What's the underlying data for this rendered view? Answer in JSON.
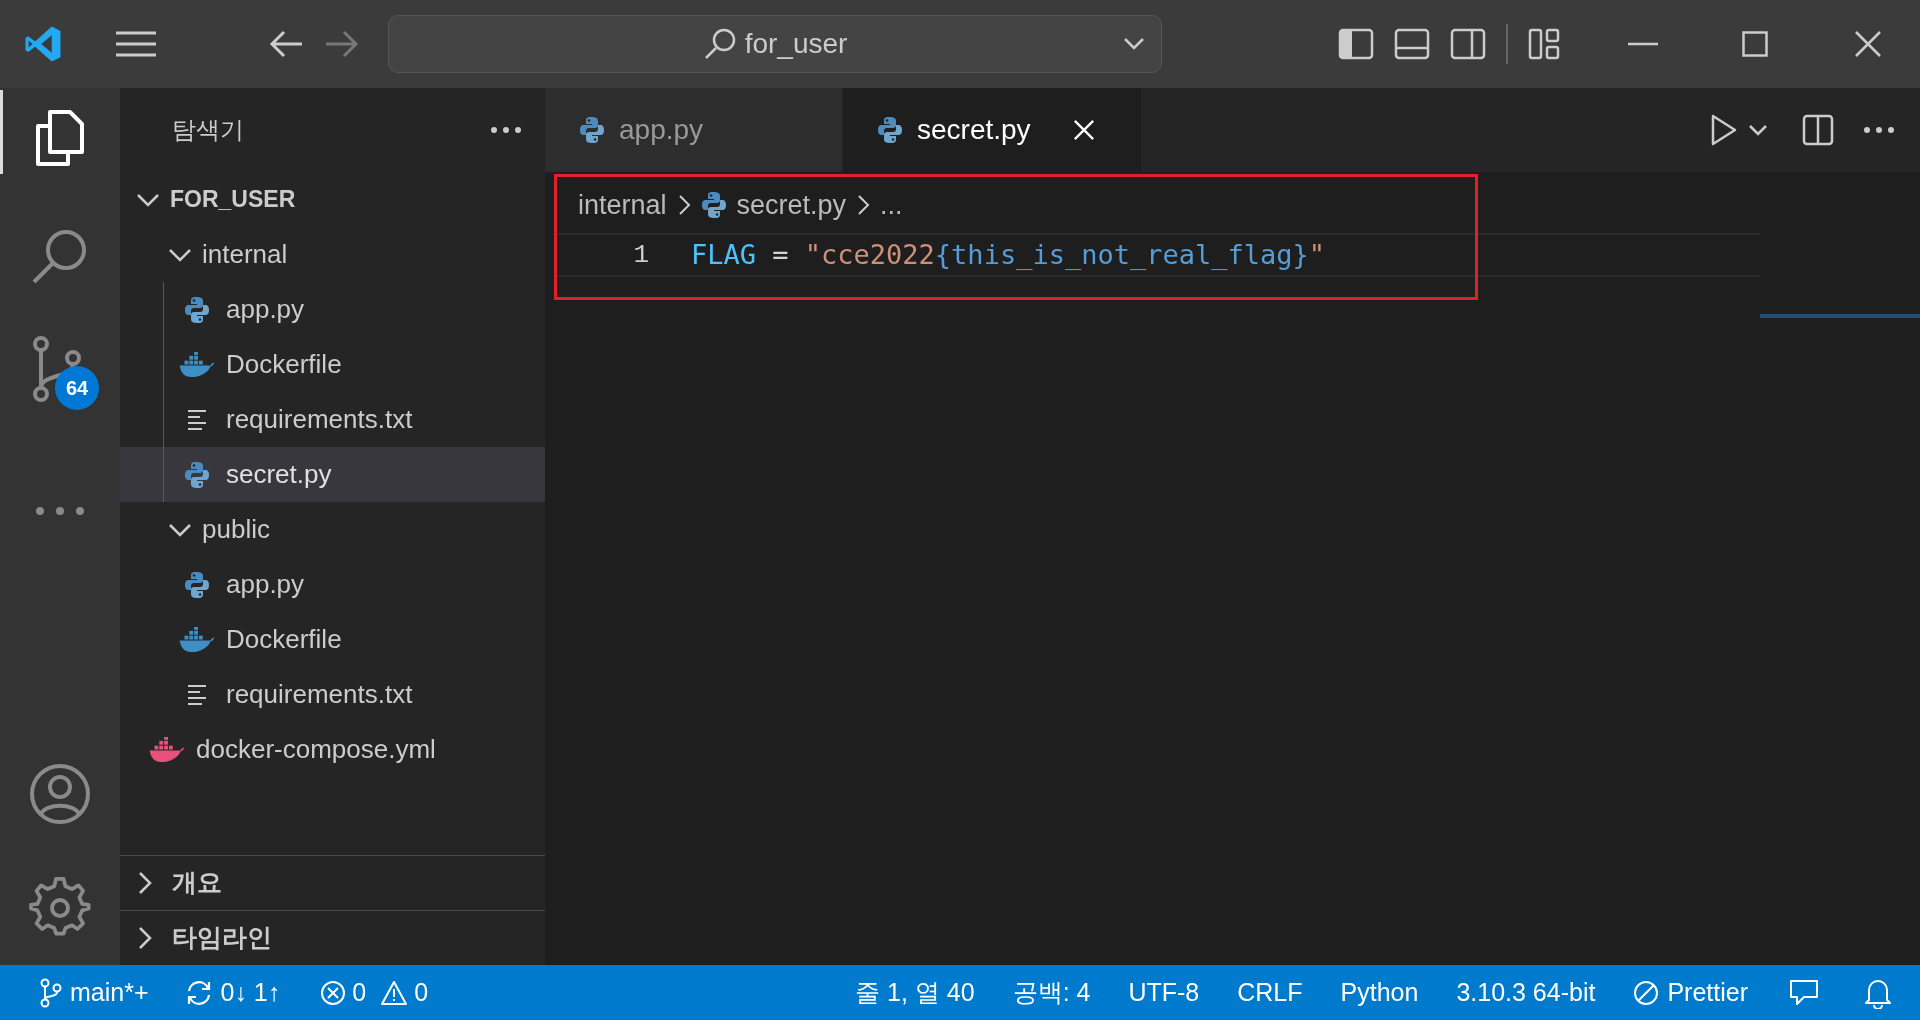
{
  "title_bar": {
    "search": "for_user"
  },
  "activity_bar": {
    "source_control_badge": "64"
  },
  "sidebar": {
    "title": "탐색기",
    "tree": [
      {
        "label": "FOR_USER",
        "kind": "root",
        "expanded": true,
        "selected": false,
        "children": [
          {
            "label": "internal",
            "kind": "folder",
            "expanded": true,
            "selected": false,
            "children": [
              {
                "label": "app.py",
                "kind": "python",
                "selected": false
              },
              {
                "label": "Dockerfile",
                "kind": "docker",
                "selected": false
              },
              {
                "label": "requirements.txt",
                "kind": "text",
                "selected": false
              },
              {
                "label": "secret.py",
                "kind": "python",
                "selected": true
              }
            ]
          },
          {
            "label": "public",
            "kind": "folder",
            "expanded": true,
            "selected": false,
            "children": [
              {
                "label": "app.py",
                "kind": "python",
                "selected": false
              },
              {
                "label": "Dockerfile",
                "kind": "docker",
                "selected": false
              },
              {
                "label": "requirements.txt",
                "kind": "text",
                "selected": false
              }
            ]
          },
          {
            "label": "docker-compose.yml",
            "kind": "compose",
            "selected": false
          }
        ]
      }
    ],
    "sections": [
      {
        "label": "개요",
        "expanded": false
      },
      {
        "label": "타임라인",
        "expanded": false
      }
    ]
  },
  "tabs": [
    {
      "label": "app.py",
      "selected": false
    },
    {
      "label": "secret.py",
      "selected": true
    }
  ],
  "breadcrumb": [
    "internal",
    "secret.py",
    "..."
  ],
  "code": [
    {
      "number": "1",
      "tokens": [
        {
          "text": "FLAG",
          "kind": "variable"
        },
        {
          "text": " = ",
          "kind": "operator"
        },
        {
          "text": "\"cce2022",
          "kind": "string"
        },
        {
          "text": "{this_is_not_real_flag}",
          "kind": "brace"
        },
        {
          "text": "\"",
          "kind": "string"
        }
      ]
    }
  ],
  "status_bar": {
    "branch": "main*+",
    "sync": "0↓ 1↑",
    "errors": "0",
    "warnings": "0",
    "right": [
      "줄 1, 열 40",
      "공백: 4",
      "UTF-8",
      "CRLF",
      "Python",
      "3.10.3 64-bit"
    ],
    "prettier": "Prettier"
  }
}
